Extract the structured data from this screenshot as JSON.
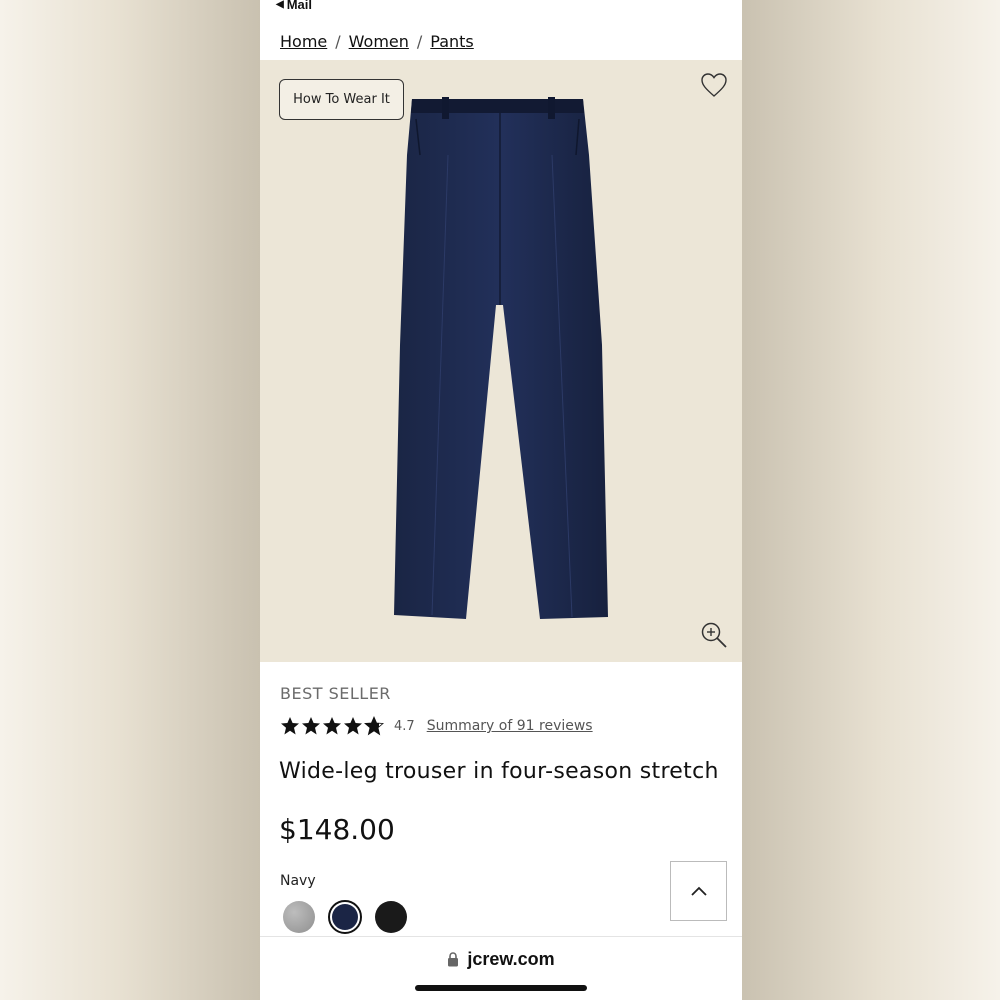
{
  "status_bar": {
    "back_label": "Mail"
  },
  "breadcrumb": {
    "items": [
      "Home",
      "Women",
      "Pants"
    ],
    "separator": "/"
  },
  "hero": {
    "how_to_wear_label": "How To Wear It",
    "product_color": "#1c2a4f"
  },
  "product": {
    "badge": "BEST SELLER",
    "rating": "4.7",
    "rating_value": 4.7,
    "rating_max": 5,
    "reviews_link": "Summary of 91 reviews",
    "title": "Wide-leg trouser in four-season stretch",
    "price": "$148.00",
    "selected_color": "Navy",
    "swatches": [
      {
        "name": "gray",
        "color": "#a5a5a5",
        "selected": false
      },
      {
        "name": "navy",
        "color": "#1b2545",
        "selected": true
      },
      {
        "name": "black",
        "color": "#1a1a1a",
        "selected": false
      }
    ]
  },
  "browser": {
    "url": "jcrew.com"
  }
}
